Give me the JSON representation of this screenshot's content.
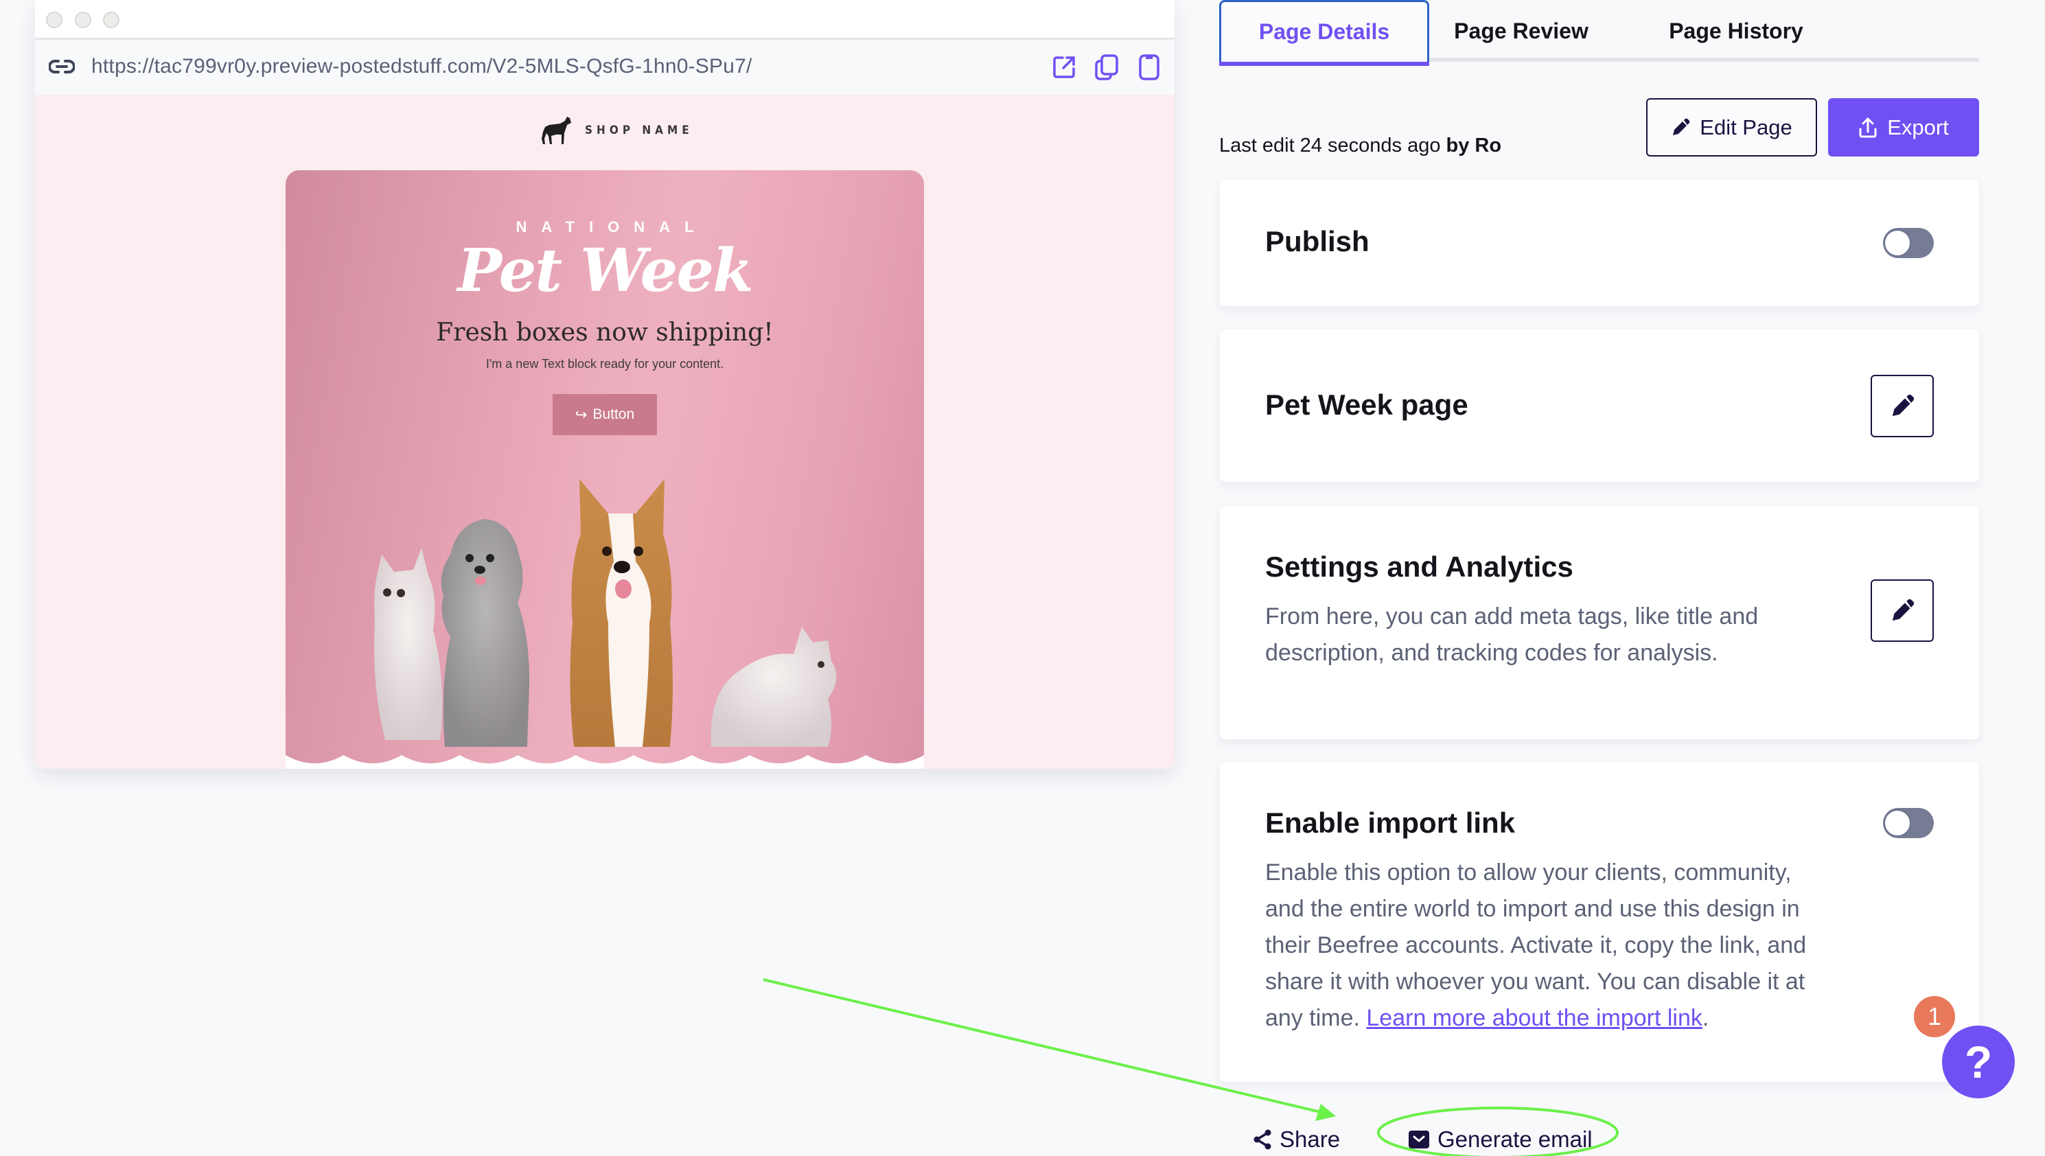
{
  "preview": {
    "url": "https://tac799vr0y.preview-postedstuff.com/V2-5MLS-QsfG-1hn0-SPu7/",
    "actions": [
      {
        "icon": "open-external-icon"
      },
      {
        "icon": "copy-icon"
      },
      {
        "icon": "mobile-view-icon"
      }
    ],
    "email": {
      "shop_name": "SHOP NAME",
      "eyebrow": "NATIONAL",
      "script_title": "Pet Week",
      "headline": "Fresh boxes now shipping!",
      "subtext": "I'm a new Text block ready for your content.",
      "button_label": "Button"
    }
  },
  "tabs": [
    {
      "label": "Page Details",
      "active": true
    },
    {
      "label": "Page Review",
      "active": false
    },
    {
      "label": "Page History",
      "active": false
    }
  ],
  "last_edit": {
    "prefix": "Last edit 24 seconds ago",
    "by": "by Ro"
  },
  "toolbar": {
    "edit_label": "Edit Page",
    "export_label": "Export"
  },
  "cards": {
    "publish": {
      "title": "Publish",
      "enabled": false
    },
    "page": {
      "title": "Pet Week page"
    },
    "settings": {
      "title": "Settings and Analytics",
      "description_line1": "From here, you can add meta tags, like title and",
      "description_line2": "description, and tracking codes for analysis."
    },
    "import": {
      "title": "Enable import link",
      "enabled": false,
      "line1": "Enable this option to allow your clients, community,",
      "line2": "and the entire world to import and use this design in",
      "line3": "their Beefree accounts. Activate it, copy the link, and",
      "line4": "share it with whoever you want. You can disable it at",
      "line5_prefix": "any time. ",
      "link_text": "Learn more about the import link",
      "line5_suffix": "."
    }
  },
  "bottom_actions": {
    "share_label": "Share",
    "generate_email_label": "Generate email"
  },
  "help": {
    "label": "?",
    "notification_count": "1"
  },
  "colors": {
    "accent": "#7050f2",
    "dark": "#1c1240",
    "annotation": "#6cf04a",
    "badge": "#e8795a"
  }
}
